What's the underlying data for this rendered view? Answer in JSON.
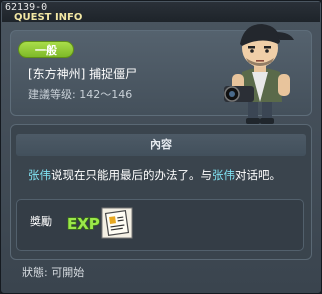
{
  "window": {
    "id_label": "62139-0",
    "title": "QUEST INFO",
    "close_symbol": "✕"
  },
  "quest": {
    "category_badge": "一般",
    "name": "[东方神州] 捕捉僵尸",
    "level_label": "建議等级: 142～146",
    "npc_icon": "photographer-npc-icon"
  },
  "content": {
    "header": "內容",
    "description_parts": [
      {
        "text": "张伟",
        "highlight": true
      },
      {
        "text": "说现在只能用最后的办法了。与",
        "highlight": false
      },
      {
        "text": "张伟",
        "highlight": true
      },
      {
        "text": "对话吧。",
        "highlight": false
      }
    ]
  },
  "rewards": {
    "label": "獎勵",
    "items": [
      {
        "icon": "exp-icon",
        "text": "EXP"
      },
      {
        "icon": "scroll-item-icon"
      }
    ]
  },
  "status": {
    "text": "狀態: 可開始"
  },
  "colors": {
    "highlight": "#7fe0f0",
    "badge": "#8fca35",
    "title": "#f2e7a4"
  }
}
